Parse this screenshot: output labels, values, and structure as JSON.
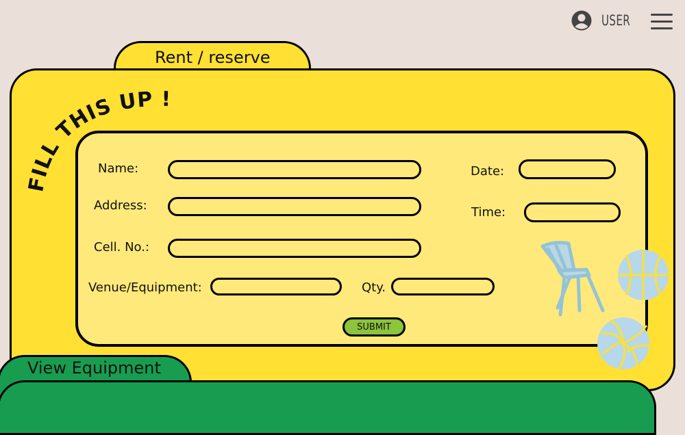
{
  "header": {
    "user_label": "USER",
    "avatar_icon": "user-circle-icon",
    "menu_icon": "hamburger-menu-icon"
  },
  "tabs": {
    "rent_label": "Rent / reserve",
    "view_label": "View Equipment"
  },
  "form": {
    "title": "FILL THIS UP !",
    "name_label": "Name:",
    "address_label": "Address:",
    "cell_label": "Cell. No.:",
    "venue_label": "Venue/Equipment:",
    "qty_label": "Qty.",
    "date_label": "Date:",
    "time_label": "Time:",
    "submit_label": "SUBMIT",
    "values": {
      "name": "",
      "address": "",
      "cell": "",
      "venue": "",
      "qty": "",
      "date": "",
      "time": ""
    }
  },
  "decorations": [
    "chair-icon",
    "basketball-icon",
    "volleyball-icon"
  ],
  "colors": {
    "background": "#ebdfd9",
    "panel_yellow": "#ffe033",
    "form_yellow": "#ffe97a",
    "green": "#189d50",
    "submit_green": "#8cc43c",
    "sports_blue": "#b7d8ea"
  }
}
